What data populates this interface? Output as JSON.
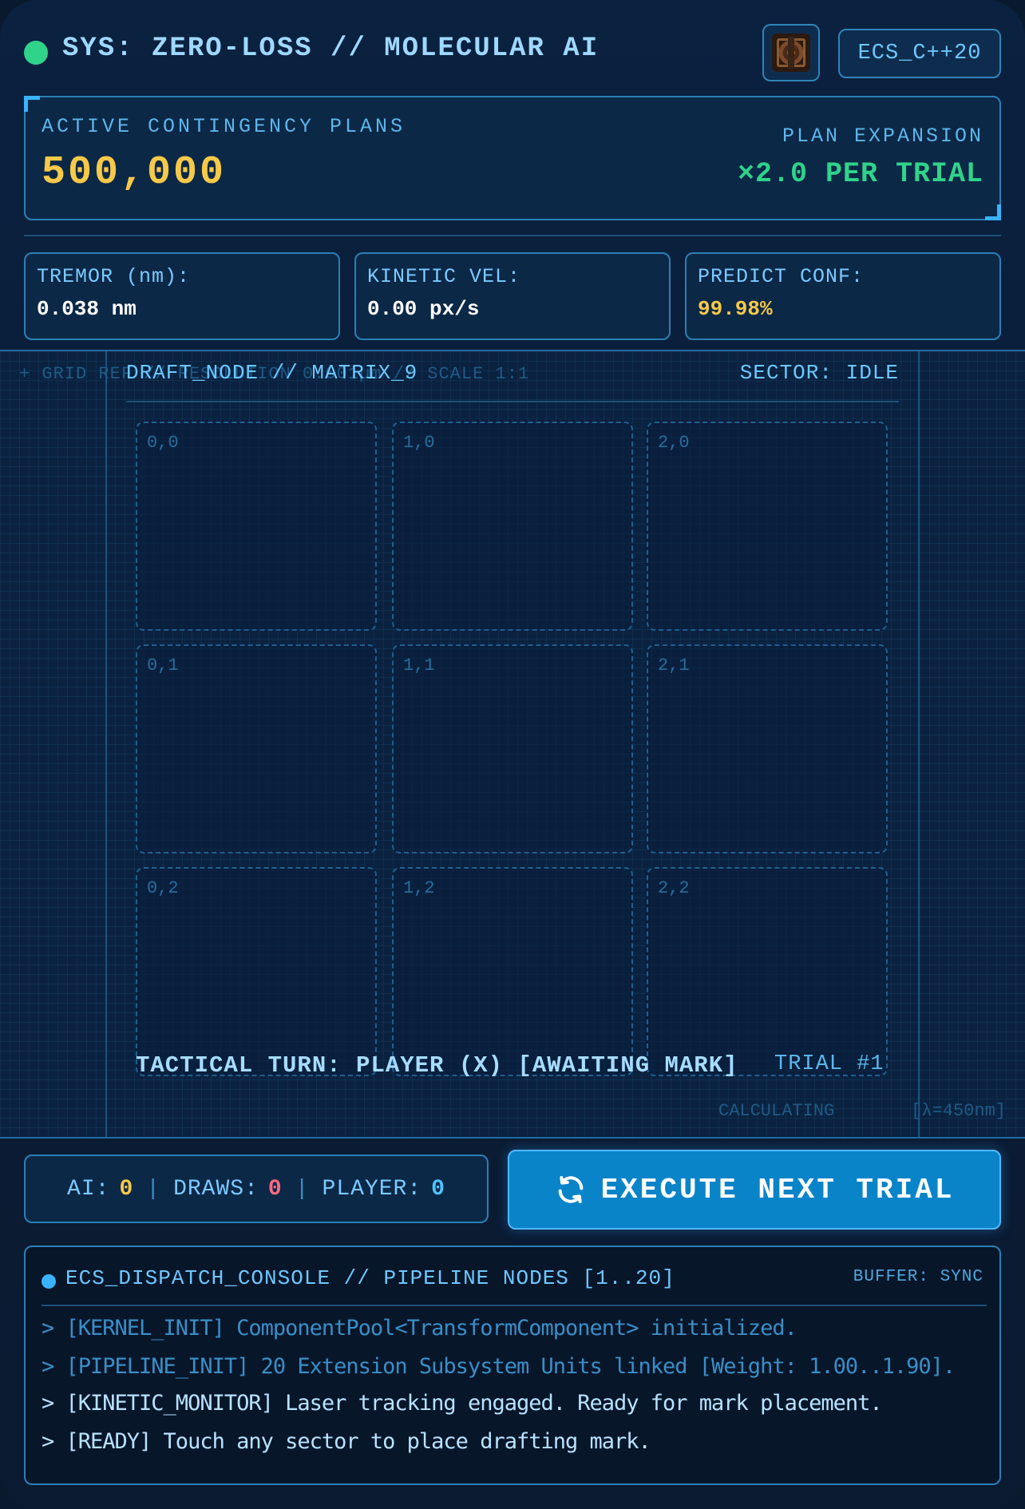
{
  "header": {
    "title": "SYS: ZERO-LOSS // MOLECULAR AI",
    "badge": "ECS_C++20",
    "chip_icon": "microchip-icon",
    "status_color": "#2fd38a"
  },
  "plans": {
    "label": "ACTIVE CONTINGENCY PLANS",
    "value": "500,000",
    "expansion_label": "PLAN EXPANSION",
    "expansion_value": "×2.0 PER TRIAL"
  },
  "metrics": [
    {
      "label": "TREMOR (nm):",
      "value": "0.038 nm"
    },
    {
      "label": "KINETIC VEL:",
      "value": "0.00 px/s"
    },
    {
      "label": "PREDICT CONF:",
      "value": "99.98%"
    }
  ],
  "matrix": {
    "grid_ref": "+ GRID REF // RESOLUTION 0.001µm // SCALE 1:1",
    "node_title": "DRAFT_NODE // MATRIX_9",
    "sector": "SECTOR: IDLE",
    "calc_ghost": "CALCULATING",
    "lambda": "[λ=450nm]",
    "cells": [
      "0,0",
      "1,0",
      "2,0",
      "0,1",
      "1,1",
      "2,1",
      "0,2",
      "1,2",
      "2,2"
    ],
    "turn": "TACTICAL TURN: PLAYER (X) [AWAITING MARK]",
    "trial": "TRIAL #1"
  },
  "score": {
    "ai_label": "AI:",
    "ai_value": "0",
    "draws_label": "DRAWS:",
    "draws_value": "0",
    "player_label": "PLAYER:",
    "player_value": "0",
    "separator": "|"
  },
  "execute": {
    "label": "EXECUTE NEXT TRIAL",
    "icon": "refresh-icon"
  },
  "console": {
    "title": "ECS_DISPATCH_CONSOLE // PIPELINE NODES [1..20]",
    "buffer": "BUFFER: SYNC",
    "lines": [
      "> [KERNEL_INIT] ComponentPool<TransformComponent> initialized.",
      "> [PIPELINE_INIT] 20 Extension Subsystem Units linked [Weight: 1.00..1.90].",
      "> [KINETIC_MONITOR] Laser tracking engaged. Ready for mark placement.",
      "> [READY] Touch any sector to place drafting mark."
    ]
  }
}
